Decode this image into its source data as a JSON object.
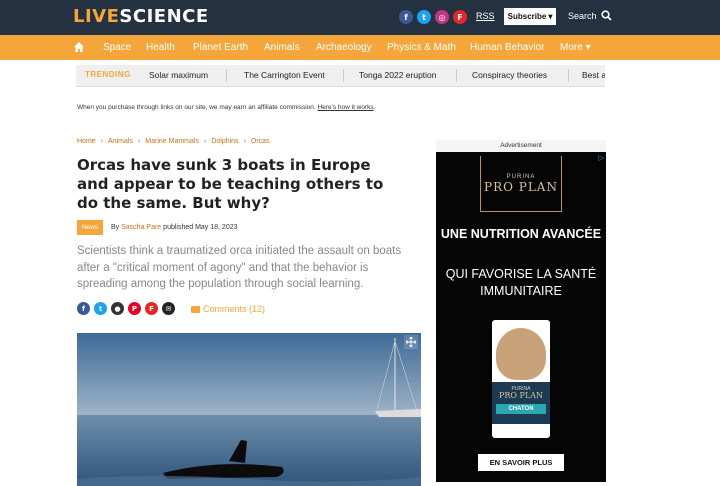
{
  "header": {
    "logo_live": "LIVE",
    "logo_science": "SCIENCE",
    "social_icons": [
      "facebook-icon",
      "twitter-icon",
      "instagram-icon",
      "flipboard-icon"
    ],
    "rss_label": "RSS",
    "subscribe_label": "Subscribe",
    "search_label": "Search"
  },
  "nav": {
    "items": [
      "Space",
      "Health",
      "Planet Earth",
      "Animals",
      "Archaeology",
      "Physics & Math",
      "Human Behavior",
      "More"
    ]
  },
  "trending": {
    "label": "TRENDING",
    "items": [
      "Solar maximum",
      "The Carrington Event",
      "Tonga 2022 eruption",
      "Conspiracy theories",
      "Best a"
    ]
  },
  "affiliate": {
    "text": "When you purchase through links on our site, we may earn an affiliate commission.",
    "link": "Here's how it works"
  },
  "breadcrumb": [
    "Home",
    "Animals",
    "Marine Mammals",
    "Dolphins",
    "Orcas"
  ],
  "article": {
    "title": "Orcas have sunk 3 boats in Europe and appear to be teaching others to do the same. But why?",
    "badge": "News",
    "by": "By",
    "author": "Sascha Pare",
    "published": "published May 18, 2023",
    "subtitle": "Scientists think a traumatized orca initiated the assault on boats after a \"critical moment of agony\" and that the behavior is spreading among the population through social learning.",
    "comments": "Comments (12)"
  },
  "ad": {
    "label": "Advertisement",
    "brand_top": "PURINA",
    "brand_name": "PRO PLAN",
    "headline": "UNE NUTRITION AVANCÉE",
    "subhead": "QUI FAVORISE LA SANTÉ IMMUNITAIRE",
    "bag_purina": "PURINA",
    "bag_brand": "PRO PLAN",
    "bag_variant": "CHATON",
    "cta": "EN SAVOIR PLUS"
  },
  "colors": {
    "header_bg": "#233140",
    "accent": "#f4a63b",
    "link": "#c76f1a"
  }
}
